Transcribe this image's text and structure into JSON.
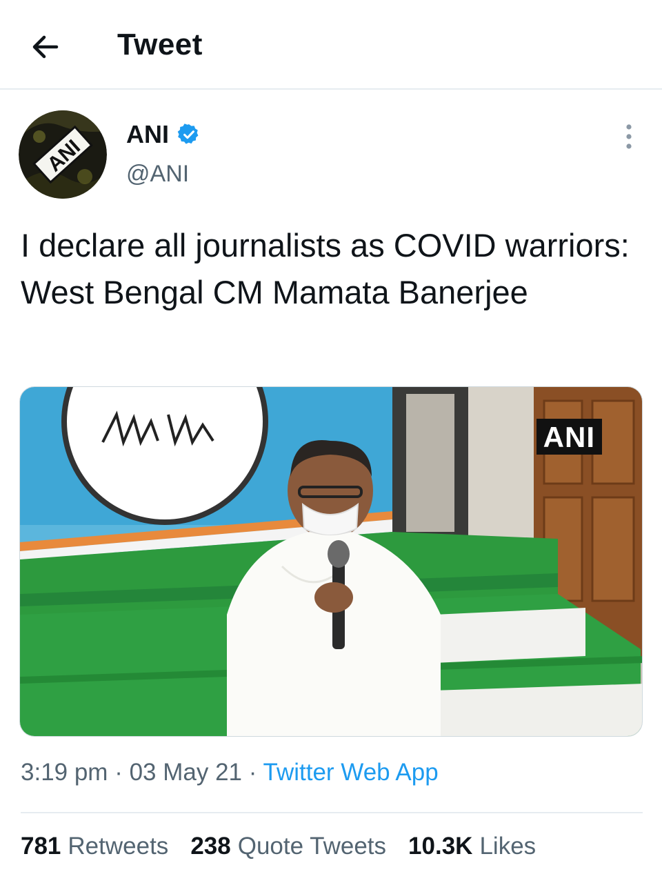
{
  "header": {
    "title": "Tweet"
  },
  "author": {
    "name": "ANI",
    "handle": "@ANI",
    "avatar_text": "ANI"
  },
  "tweet": {
    "text": "I declare all journalists as COVID warriors: West Bengal CM Mamata Banerjee",
    "media_watermark": "ANI",
    "time": "3:19 pm",
    "date": "03 May 21",
    "source": "Twitter Web App"
  },
  "stats": {
    "retweets_count": "781",
    "retweets_label": "Retweets",
    "quotes_count": "238",
    "quotes_label": "Quote Tweets",
    "likes_count": "10.3K",
    "likes_label": "Likes"
  },
  "colors": {
    "accent": "#1d9bf0",
    "secondary_text": "#536471",
    "divider": "#e6ecf0"
  }
}
